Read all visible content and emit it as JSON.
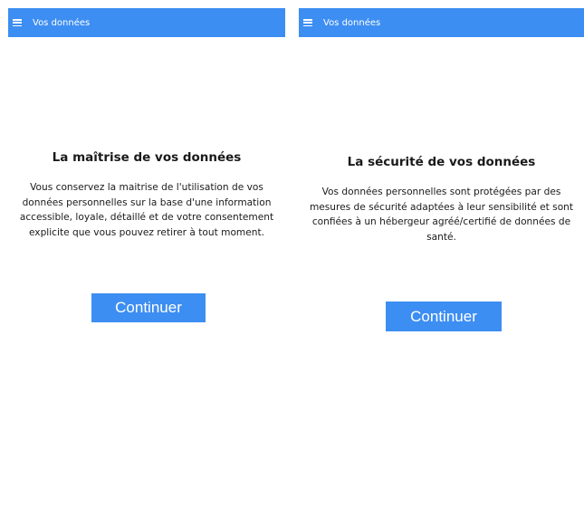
{
  "screens": [
    {
      "appbar": {
        "icon": "menu-icon",
        "title": "Vos données"
      },
      "heading": "La maîtrise de vos données",
      "body_lines": [
        "Vous conservez la maitrise de l'utilisation de vos",
        "données personnelles sur la base d'une information",
        "accessible, loyale, détaillé et de votre consentement",
        "explicite que vous pouvez retirer à tout moment."
      ],
      "button_label": "Continuer"
    },
    {
      "appbar": {
        "icon": "menu-icon",
        "title": "Vos données"
      },
      "heading": "La sécurité de vos données",
      "body_lines": [
        "Vos données personnelles sont protégées par des",
        "mesures de sécurité adaptées à leur sensibilité et sont",
        "confiées à un hébergeur agréé/certifié de données de",
        "santé."
      ],
      "button_label": "Continuer"
    }
  ],
  "colors": {
    "accent": "#3d8ef2",
    "text": "#1a1a1a",
    "background": "#ffffff"
  }
}
